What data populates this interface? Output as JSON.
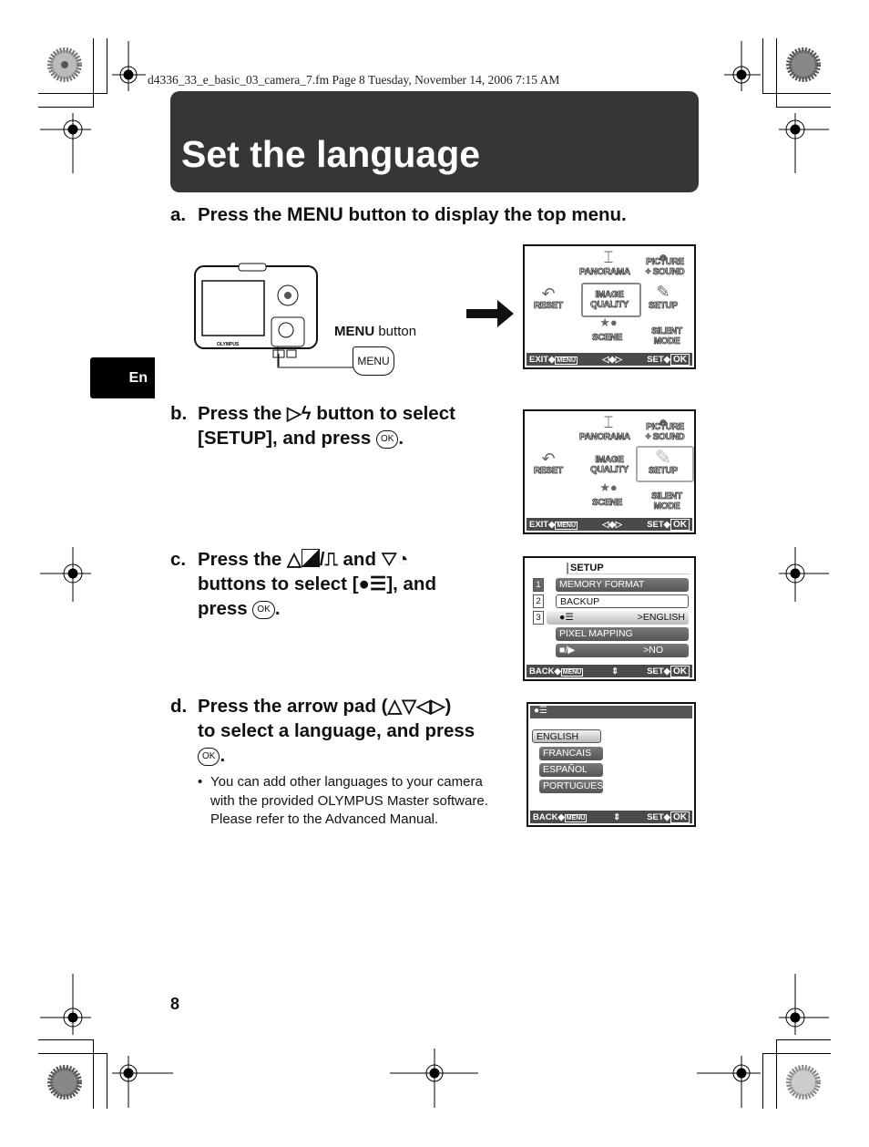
{
  "header": {
    "file_info": "d4336_33_e_basic_03_camera_7.fm  Page 8  Tuesday, November 14, 2006  7:15 AM"
  },
  "title": "Set the language",
  "language_tab": "En",
  "page_number": "8",
  "steps": [
    {
      "letter": "a.",
      "text_before": "Press the ",
      "button_name": "MENU",
      "text_after": " button to display the top menu."
    },
    {
      "letter": "b.",
      "line1": "Press the ▷",
      "icon": "flash",
      "line1_end": " button to select",
      "line2": "[SETUP], and press ",
      "ok": "OK",
      "end": "."
    },
    {
      "letter": "c.",
      "line1": "Press the △",
      "line1_mid": "/",
      "line1_end": " and ▽",
      "line2": "buttons to select [",
      "line2_end": "], and",
      "line3": "press ",
      "ok": "OK",
      "end": "."
    },
    {
      "letter": "d.",
      "line1": "Press the arrow pad (△▽◁▷)",
      "line2": "to select a language, and press",
      "ok": "OK",
      "end": "."
    }
  ],
  "note": {
    "bullet": "•",
    "lines": [
      "You can add other languages to your camera",
      "with the provided OLYMPUS Master software.",
      "Please refer to the Advanced Manual."
    ]
  },
  "camera_illustration": {
    "label_bold": "MENU",
    "label_rest": " button",
    "button_text": "MENU",
    "brand": "OLYMPUS"
  },
  "top_menu": {
    "items": {
      "panorama": "PANORAMA",
      "picture_sound_1": "PICTURE",
      "picture_sound_2": "+ SOUND",
      "reset": "RESET",
      "image_quality_1": "IMAGE",
      "image_quality_2": "QUALITY",
      "setup": "SETUP",
      "scene": "SCENE",
      "silent_1": "SILENT",
      "silent_2": "MODE"
    },
    "bar": {
      "left": "EXIT◆",
      "left_btn": "MENU",
      "center": "◁◆▷",
      "right": "SET◆",
      "right_btn": "OK"
    }
  },
  "setup_menu": {
    "title": "SETUP",
    "pages": [
      "1",
      "2",
      "3"
    ],
    "rows": [
      {
        "label": "MEMORY FORMAT",
        "value": ""
      },
      {
        "label": "BACKUP",
        "value": ""
      },
      {
        "label": "",
        "value": ">ENGLISH"
      },
      {
        "label": "PIXEL MAPPING",
        "value": ""
      },
      {
        "label": "",
        "value": ">NO"
      }
    ],
    "bar": {
      "left": "BACK◆",
      "left_btn": "MENU",
      "center": "⇕",
      "right": "SET◆",
      "right_btn": "OK"
    }
  },
  "language_menu": {
    "options": [
      "ENGLISH",
      "FRANCAIS",
      "ESPAÑOL",
      "PORTUGUES"
    ],
    "selected": "ENGLISH",
    "bar": {
      "left": "BACK◆",
      "left_btn": "MENU",
      "center": "⇕",
      "right": "SET◆",
      "right_btn": "OK"
    }
  }
}
